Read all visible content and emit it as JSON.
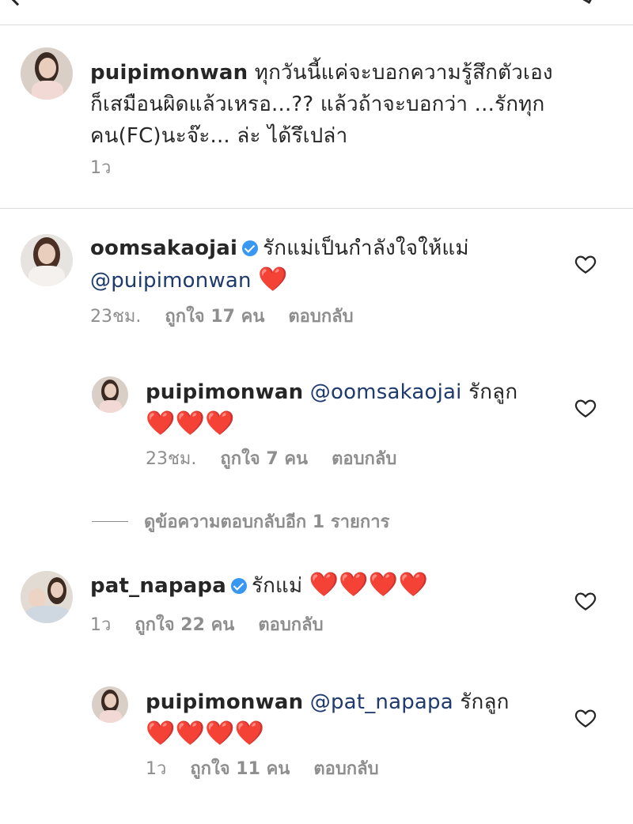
{
  "caption": {
    "username": "puipimonwan",
    "line1": "ทุกวันนี้แค่จะบอกความรู้สึกตัวเอง",
    "line2": "ก็เสมือนผิดแล้วเหรอ...?? แล้วถ้าจะบอกว่า ...รักทุก",
    "line3": "คน(FC)นะจ๊ะ... ล่ะ ได้รึเปล่า",
    "time": "1ว"
  },
  "comments": [
    {
      "username": "oomsakaojai",
      "verified": true,
      "text": "รักแม่เป็นกำลังใจให้แม่",
      "mention": "@puipimonwan",
      "hearts": "❤️",
      "time": "23ชม.",
      "likes": "ถูกใจ 17 คน",
      "reply": "ตอบกลับ",
      "replies": [
        {
          "username": "puipimonwan",
          "mention": "@oomsakaojai",
          "text": "รักลูก",
          "hearts": "❤️❤️❤️",
          "time": "23ชม.",
          "likes": "ถูกใจ 7 คน",
          "reply": "ตอบกลับ"
        }
      ],
      "view_more": "ดูข้อความตอบกลับอีก 1 รายการ"
    },
    {
      "username": "pat_napapa",
      "verified": true,
      "text": "รักแม่",
      "hearts": "❤️❤️❤️❤️",
      "time": "1ว",
      "likes": "ถูกใจ 22 คน",
      "reply": "ตอบกลับ",
      "replies": [
        {
          "username": "puipimonwan",
          "mention": "@pat_napapa",
          "text": "รักลูก",
          "hearts": "❤️❤️❤️❤️",
          "time": "1ว",
          "likes": "ถูกใจ 11 คน",
          "reply": "ตอบกลับ"
        }
      ]
    }
  ],
  "colors": {
    "mention": "#1e3a6e",
    "verified": "#3897f0",
    "meta": "#8e8e8e",
    "heart_emoji": "#e0192b"
  },
  "icons": [
    "back-arrow-icon",
    "share-icon",
    "verified-badge-icon",
    "like-heart-icon"
  ]
}
